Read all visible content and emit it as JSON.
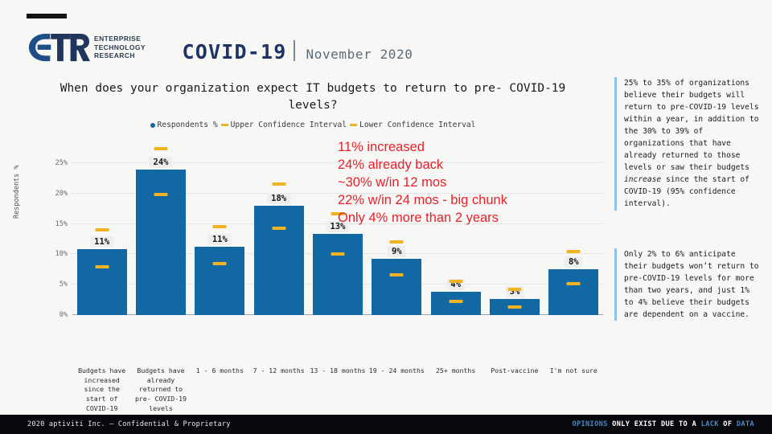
{
  "brand": {
    "logo_letters": "ETR",
    "logo_line1": "ENTERPRISE",
    "logo_line2": "TECHNOLOGY",
    "logo_line3": "RESEARCH",
    "navy": "#1c3461",
    "bar_blue": "#1268a3",
    "ci_gold": "#f0b323",
    "annotation_red": "#e8202a",
    "accent_light_blue": "#8fc4e8"
  },
  "header": {
    "title": "COVID-19",
    "date": "November 2020"
  },
  "chart_data": {
    "type": "bar",
    "title": "When does your organization expect IT budgets to return to pre- COVID-19 levels?",
    "xlabel": "",
    "ylabel": "Respondents %",
    "ylim": [
      0,
      27.5
    ],
    "grid": true,
    "legend_position": "top-center",
    "legend": [
      {
        "name": "Respondents %",
        "marker": "dot",
        "color": "#1268a3"
      },
      {
        "name": "Upper Confidence Interval",
        "marker": "dash",
        "color": "#f0b323"
      },
      {
        "name": "Lower Confidence Interval",
        "marker": "dash",
        "color": "#f0b323"
      }
    ],
    "yticks": [
      "0%",
      "5%",
      "10%",
      "15%",
      "20%",
      "25%"
    ],
    "ytick_values": [
      0,
      5,
      10,
      15,
      20,
      25
    ],
    "categories": [
      "Budgets have increased since the start of COVID-19",
      "Budgets have already returned to pre- COVID-19 levels",
      "1 - 6 months",
      "7 - 12 months",
      "13 - 18 months",
      "19 - 24 months",
      "25+ months",
      "Post-vaccine",
      "I'm not sure"
    ],
    "data_labels": [
      "11%",
      "24%",
      "11%",
      "18%",
      "13%",
      "9%",
      "4%",
      "3%",
      "8%"
    ],
    "series": [
      {
        "name": "Respondents %",
        "values": [
          10.8,
          23.9,
          11.3,
          18.0,
          13.3,
          9.2,
          3.9,
          2.7,
          7.6
        ]
      },
      {
        "name": "Upper Confidence Interval",
        "values": [
          14.0,
          27.4,
          14.5,
          21.5,
          16.6,
          12.0,
          5.6,
          4.2,
          10.4
        ]
      },
      {
        "name": "Lower Confidence Interval",
        "values": [
          8.0,
          19.8,
          8.4,
          14.3,
          10.1,
          6.6,
          2.3,
          1.3,
          5.2
        ]
      }
    ]
  },
  "annotation": {
    "lines": [
      "11% increased",
      "24% already back",
      "~30% w/in 12 mos",
      "22% w/in 24 mos - big chunk",
      "Only 4% more than 2 years"
    ]
  },
  "sidebar": {
    "block1_part1": "25% to 35% of organizations believe their budgets will return to pre-COVID-19 levels within a year, in addition to the 30% to 39% of organizations that have already returned to those levels or saw their budgets ",
    "block1_italic": "increase",
    "block1_part2": " since the start of COVID-19 (95% confidence interval).",
    "block2": "Only 2% to 6% anticipate their budgets won’t return to pre-COVID-19 levels for more than two years, and just 1% to 4% believe their budgets are dependent on a vaccine."
  },
  "footer": {
    "left": "2020 aptiviti Inc. – Confidential & Proprietary",
    "right_seg1": "OPINIONS",
    "right_seg2": " ONLY EXIST DUE TO A ",
    "right_seg3": "LACK",
    "right_seg4": " OF ",
    "right_seg5": "DATA"
  }
}
